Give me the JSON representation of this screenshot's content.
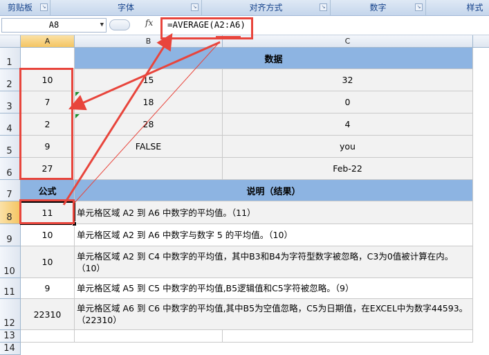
{
  "ribbon": {
    "groups": [
      "剪贴板",
      "字体",
      "对齐方式",
      "数字",
      "样式"
    ]
  },
  "formula_bar": {
    "name_box": "A8",
    "fx_label": "fx",
    "formula": "=AVERAGE(A2:A6)"
  },
  "columns": [
    "A",
    "B",
    "C"
  ],
  "rows": [
    "1",
    "2",
    "3",
    "4",
    "5",
    "6",
    "7",
    "8",
    "9",
    "10",
    "11",
    "12",
    "13",
    "14"
  ],
  "sheet": {
    "header_data": "数据",
    "data_rows": [
      {
        "a": "10",
        "b": "15",
        "c": "32"
      },
      {
        "a": "7",
        "b": "18",
        "c": "0"
      },
      {
        "a": "2",
        "b": "28",
        "c": "4"
      },
      {
        "a": "9",
        "b": "FALSE",
        "c": "you"
      },
      {
        "a": "27",
        "b": "",
        "c": "Feb-22"
      }
    ],
    "header_formula": "公式",
    "header_desc": "说明（结果）",
    "results": [
      {
        "value": "11",
        "desc": "单元格区域 A2 到 A6 中数字的平均值。（11）"
      },
      {
        "value": "10",
        "desc": "单元格区域 A2 到 A6 中数字与数字 5 的平均值。（10）"
      },
      {
        "value": "10",
        "desc": "单元格区域 A2 到 C4 中数字的平均值，其中B3和B4为字符型数字被忽略，C3为0值被计算在内。（10）"
      },
      {
        "value": "9",
        "desc": "单元格区域 A5 到 C5 中数字的平均值,B5逻辑值和C5字符被忽略。（9）"
      },
      {
        "value": "22310",
        "desc": "单元格区域 A6 到 C6 中数字的平均值,其中B5为空值忽略，C5为日期值，在EXCEL中为数字44593。（22310）"
      }
    ]
  },
  "colors": {
    "header_fill": "#8db4e2",
    "data_fill": "#f2f2f2",
    "annotation_red": "#e8453c",
    "ribbon_text": "#15428b"
  }
}
